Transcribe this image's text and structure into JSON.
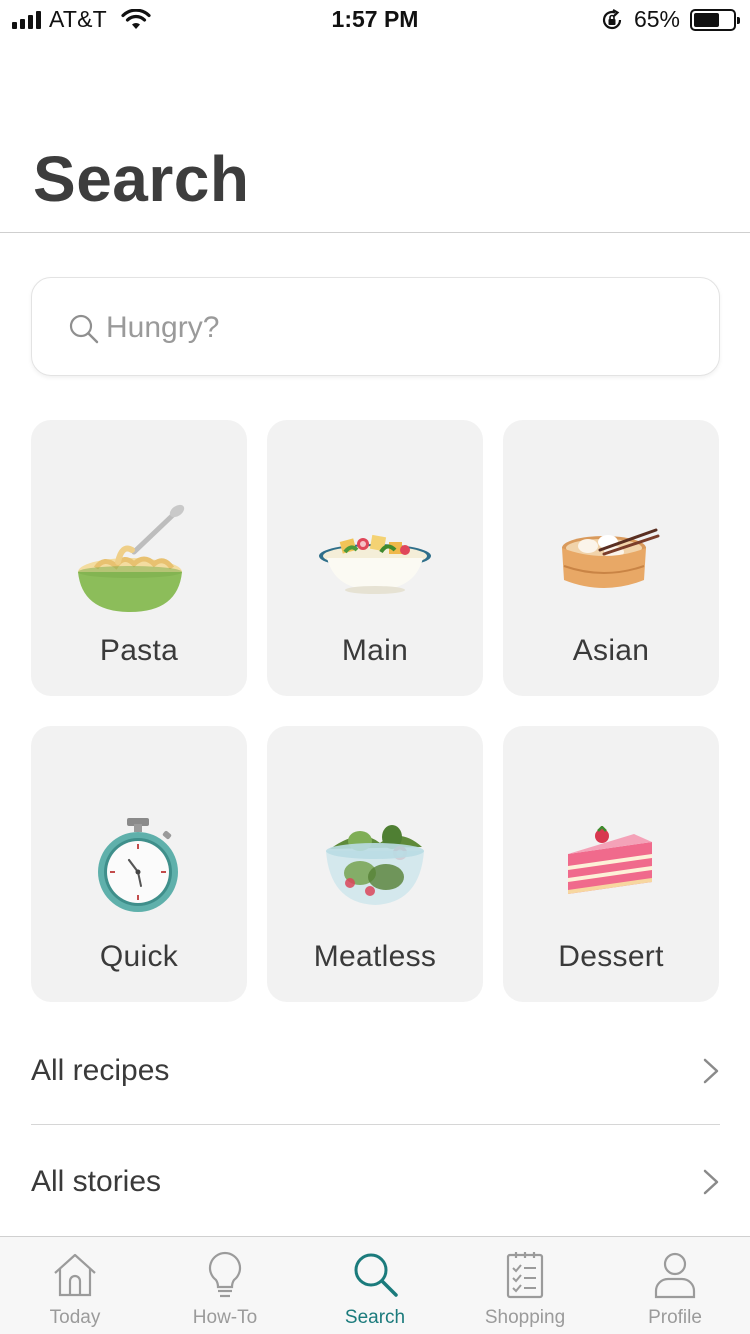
{
  "status_bar": {
    "carrier": "AT&T",
    "time": "1:57 PM",
    "battery_percent": "65%",
    "battery_level": 0.65,
    "icons": [
      "signal-icon",
      "wifi-icon",
      "rotation-lock-icon",
      "battery-icon"
    ]
  },
  "header": {
    "title": "Search"
  },
  "search": {
    "placeholder": "Hungry?",
    "icon": "search-icon"
  },
  "categories": [
    {
      "label": "Pasta",
      "icon": "pasta-bowl-icon"
    },
    {
      "label": "Main",
      "icon": "main-dish-icon"
    },
    {
      "label": "Asian",
      "icon": "dumpling-basket-icon"
    },
    {
      "label": "Quick",
      "icon": "stopwatch-icon"
    },
    {
      "label": "Meatless",
      "icon": "salad-bowl-icon"
    },
    {
      "label": "Dessert",
      "icon": "cake-slice-icon"
    }
  ],
  "links": [
    {
      "label": "All recipes",
      "icon": "chevron-right-icon"
    },
    {
      "label": "All stories",
      "icon": "chevron-right-icon"
    }
  ],
  "tab_bar": {
    "active": "Search",
    "accent_color": "#1b7b7c",
    "inactive_color": "#9b9b9b",
    "tabs": [
      {
        "label": "Today",
        "icon": "house-icon"
      },
      {
        "label": "How-To",
        "icon": "lightbulb-icon"
      },
      {
        "label": "Search",
        "icon": "search-icon"
      },
      {
        "label": "Shopping",
        "icon": "checklist-icon"
      },
      {
        "label": "Profile",
        "icon": "person-icon"
      }
    ]
  }
}
